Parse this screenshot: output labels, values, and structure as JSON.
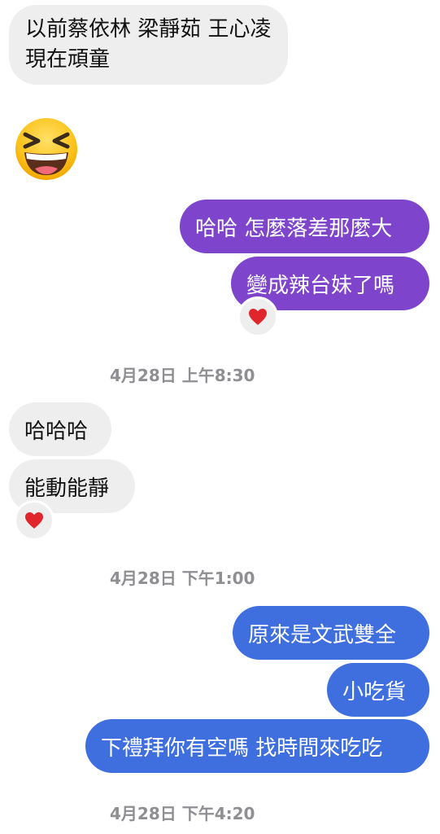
{
  "colors": {
    "incoming_bubble": "#eeeeee",
    "outgoing_purple": "#7e45cc",
    "outgoing_blue": "#3f6fdf",
    "timestamp_text": "#8e8e93",
    "heart": "#e0252d"
  },
  "messages": {
    "in_1_line_1": "以前蔡依林 梁靜茹 王心凌",
    "in_1_line_2": "現在頑童",
    "in_2_emoji": "grinning-squinting-face-emoji",
    "out_1": "哈哈 怎麼落差那麼大",
    "out_2": "變成辣台妹了嗎",
    "out_2_reaction": "heart-reaction-icon",
    "in_3": "哈哈哈",
    "in_4": "能動能靜",
    "in_4_reaction": "heart-reaction-icon",
    "out_3": "原來是文武雙全",
    "out_4": "小吃貨",
    "out_5": "下禮拜你有空嗎 找時間來吃吃"
  },
  "timestamps": {
    "t1": "4月28日 上午8:30",
    "t2": "4月28日 下午1:00",
    "t3": "4月28日 下午4:20"
  }
}
